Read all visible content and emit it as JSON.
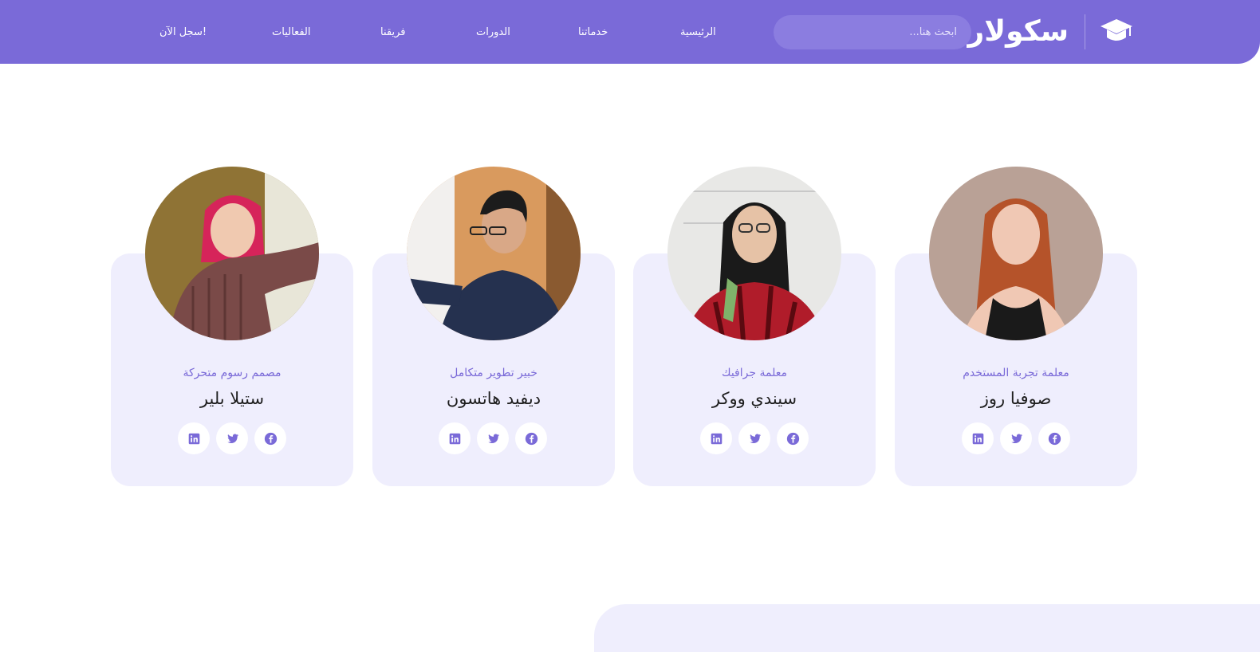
{
  "header": {
    "logo_text": "سكولار",
    "logo_icon": "graduation-cap-icon",
    "search_placeholder": "ابحث هنا...",
    "nav": [
      {
        "label": "الرئيسية"
      },
      {
        "label": "خدماتنا"
      },
      {
        "label": "الدورات"
      },
      {
        "label": "فريقنا"
      },
      {
        "label": "الفعاليات"
      },
      {
        "label": "سجل الآن!"
      }
    ]
  },
  "team": [
    {
      "name": "صوفيا روز",
      "role": "معلمة تجربة المستخدم",
      "photo": "smiling-woman-red-hair-photo"
    },
    {
      "name": "سيندي ووكر",
      "role": "معلمة جرافيك",
      "photo": "woman-glasses-whiteboard-photo"
    },
    {
      "name": "ديفيد هاتسون",
      "role": "خبير تطوير متكامل",
      "photo": "man-glasses-whiteboard-photo"
    },
    {
      "name": "ستيلا بلير",
      "role": "مصمم رسوم متحركة",
      "photo": "woman-pink-hair-photo"
    }
  ],
  "social_icons": [
    "facebook-icon",
    "twitter-icon",
    "linkedin-icon"
  ],
  "colors": {
    "primary": "#7a6ad8",
    "card_bg": "#efeefd",
    "text_dark": "#1e1e1e"
  }
}
